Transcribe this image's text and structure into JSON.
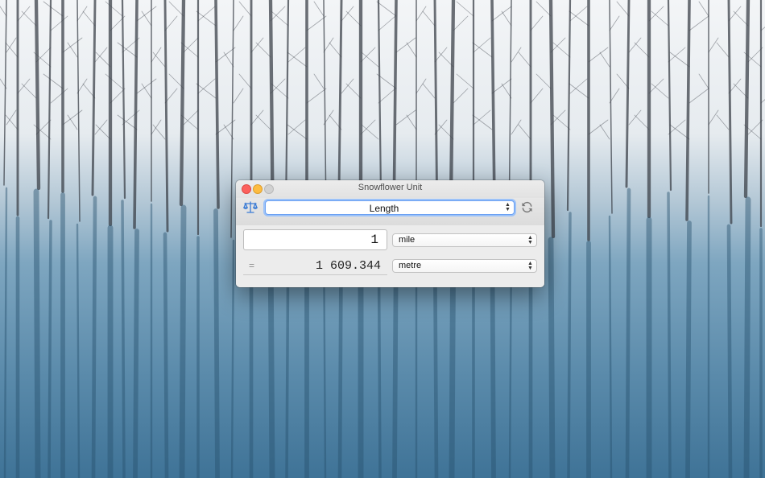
{
  "window": {
    "title": "Snowflower Unit"
  },
  "toolbar": {
    "category_icon": "scale-icon",
    "category": "Length",
    "refresh_icon": "refresh-icon"
  },
  "converter": {
    "amount": "1",
    "from_unit": "mile",
    "equals": "=",
    "result": "1 609.344",
    "to_unit": "metre"
  },
  "colors": {
    "close": "#fc605c",
    "minimize": "#fdbc40",
    "zoom": "#d1d1d1",
    "accent": "#4a90e2",
    "icon": "#3a7bd5"
  }
}
